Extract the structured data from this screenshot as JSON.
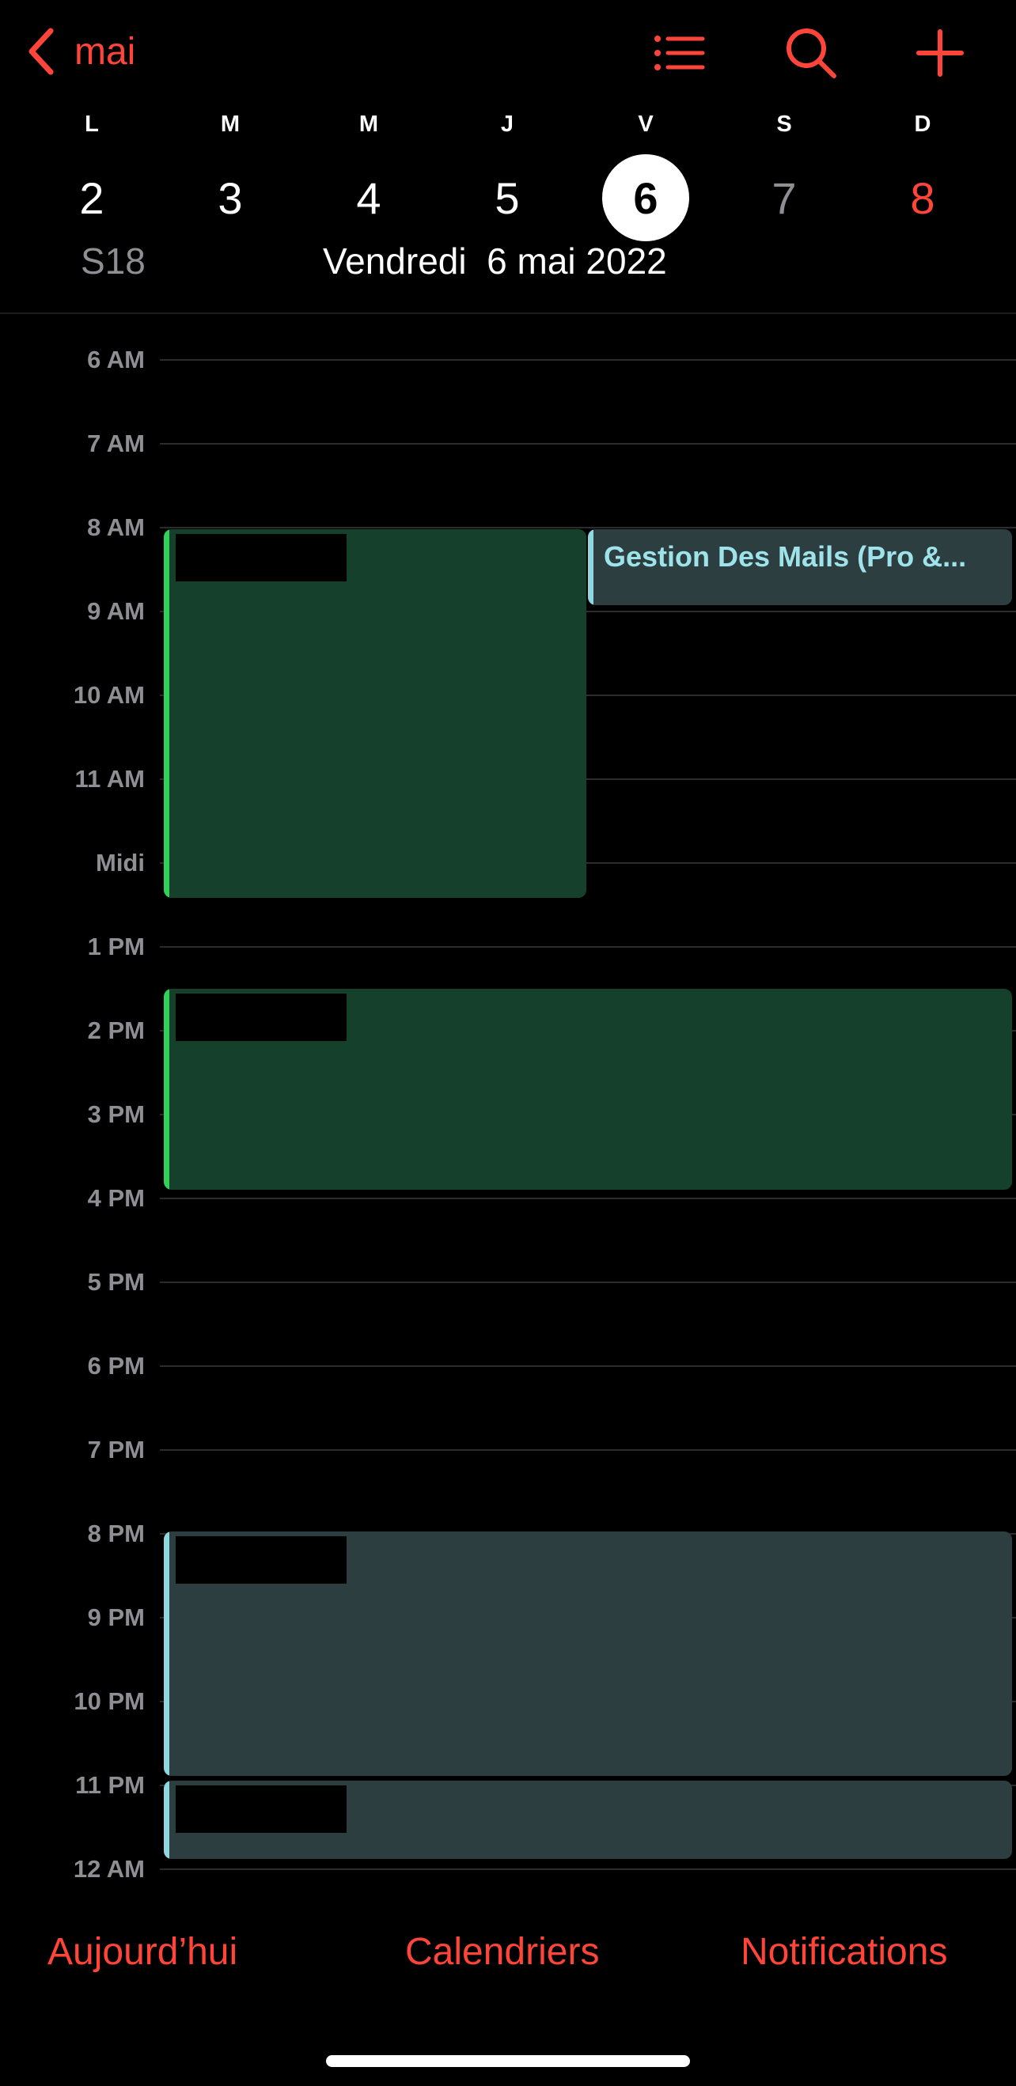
{
  "nav": {
    "back_label": "mai",
    "list_icon": "list-icon",
    "search_icon": "search-icon",
    "add_icon": "plus-icon",
    "accent": "#ff453a"
  },
  "week": {
    "days": [
      {
        "letter": "L",
        "num": "2"
      },
      {
        "letter": "M",
        "num": "3"
      },
      {
        "letter": "M",
        "num": "4"
      },
      {
        "letter": "J",
        "num": "5"
      },
      {
        "letter": "V",
        "num": "6"
      },
      {
        "letter": "S",
        "num": "7"
      },
      {
        "letter": "D",
        "num": "8"
      }
    ],
    "selected_day": "6",
    "week_number": "S18",
    "full_date": "Vendredi  6 mai 2022"
  },
  "hours": [
    "6 AM",
    "7 AM",
    "8 AM",
    "9 AM",
    "10 AM",
    "11 AM",
    "Midi",
    "1 PM",
    "2 PM",
    "3 PM",
    "4 PM",
    "5 PM",
    "6 PM",
    "7 PM",
    "8 PM",
    "9 PM",
    "10 PM",
    "11 PM",
    "12 AM"
  ],
  "events": {
    "mail_title": "Gestion Des Mails (Pro &...",
    "colors": {
      "green_fill": "#15402c",
      "green_bar": "#30d158",
      "teal_fill": "#2c3e3f",
      "teal_bar": "#8fd7e0",
      "teal_text": "#9fe3ea"
    }
  },
  "toolbar": {
    "today": "Aujourd’hui",
    "calendars": "Calendriers",
    "notifications": "Notifications"
  }
}
